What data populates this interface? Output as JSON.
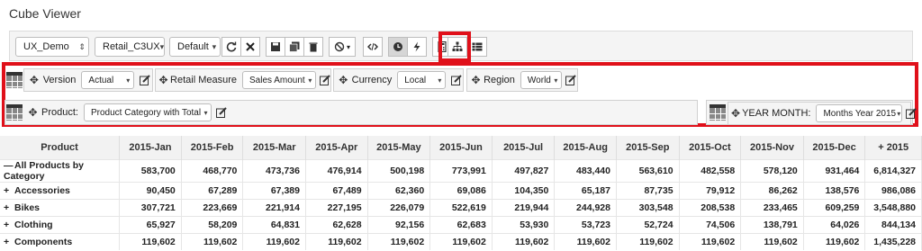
{
  "title": "Cube Viewer",
  "toolbar": {
    "cube_select": "UX_Demo",
    "view_select": "Retail_C3UX",
    "layout_select": "Default",
    "icons": [
      "refresh-icon",
      "close-icon",
      "save-icon",
      "save-as-icon",
      "delete-icon",
      "suppress-icon",
      "code-icon",
      "clock-icon",
      "lightning-icon",
      "calculator-icon",
      "hierarchy-icon",
      "table-icon"
    ]
  },
  "filters": [
    {
      "label": "Version",
      "value": "Actual"
    },
    {
      "label": "Retail Measure",
      "value": "Sales Amount"
    },
    {
      "label": "Currency",
      "value": "Local"
    },
    {
      "label": "Region",
      "value": "World"
    }
  ],
  "rows_dim": {
    "label": "Product:",
    "value": "Product Category with Total"
  },
  "cols_dim": {
    "label": "YEAR MONTH:",
    "value": "Months Year 2015"
  },
  "table": {
    "headers": [
      "Product",
      "2015-Jan",
      "2015-Feb",
      "2015-Mar",
      "2015-Apr",
      "2015-May",
      "2015-Jun",
      "2015-Jul",
      "2015-Aug",
      "2015-Sep",
      "2015-Oct",
      "2015-Nov",
      "2015-Dec",
      "+ 2015"
    ],
    "rows": [
      {
        "exp": "—",
        "name": "All Products by Category",
        "values": [
          "583,700",
          "468,770",
          "473,736",
          "476,914",
          "500,198",
          "773,991",
          "497,827",
          "483,440",
          "563,610",
          "482,558",
          "578,120",
          "931,464",
          "6,814,327"
        ]
      },
      {
        "exp": "+",
        "name": "Accessories",
        "values": [
          "90,450",
          "67,289",
          "67,389",
          "67,489",
          "62,360",
          "69,086",
          "104,350",
          "65,187",
          "87,735",
          "79,912",
          "86,262",
          "138,576",
          "986,086"
        ]
      },
      {
        "exp": "+",
        "name": "Bikes",
        "values": [
          "307,721",
          "223,669",
          "221,914",
          "227,195",
          "226,079",
          "522,619",
          "219,944",
          "244,928",
          "303,548",
          "208,538",
          "233,465",
          "609,259",
          "3,548,880"
        ]
      },
      {
        "exp": "+",
        "name": "Clothing",
        "values": [
          "65,927",
          "58,209",
          "64,831",
          "62,628",
          "92,156",
          "62,683",
          "53,930",
          "53,723",
          "52,724",
          "74,506",
          "138,791",
          "64,026",
          "844,134"
        ]
      },
      {
        "exp": "+",
        "name": "Components",
        "values": [
          "119,602",
          "119,602",
          "119,602",
          "119,602",
          "119,602",
          "119,602",
          "119,602",
          "119,602",
          "119,602",
          "119,602",
          "119,602",
          "119,602",
          "1,435,228"
        ]
      }
    ]
  },
  "colors": {
    "highlight": "#e0101a",
    "toolbar_bg": "#f4f4f4",
    "header_bg": "#f2f2f2"
  }
}
